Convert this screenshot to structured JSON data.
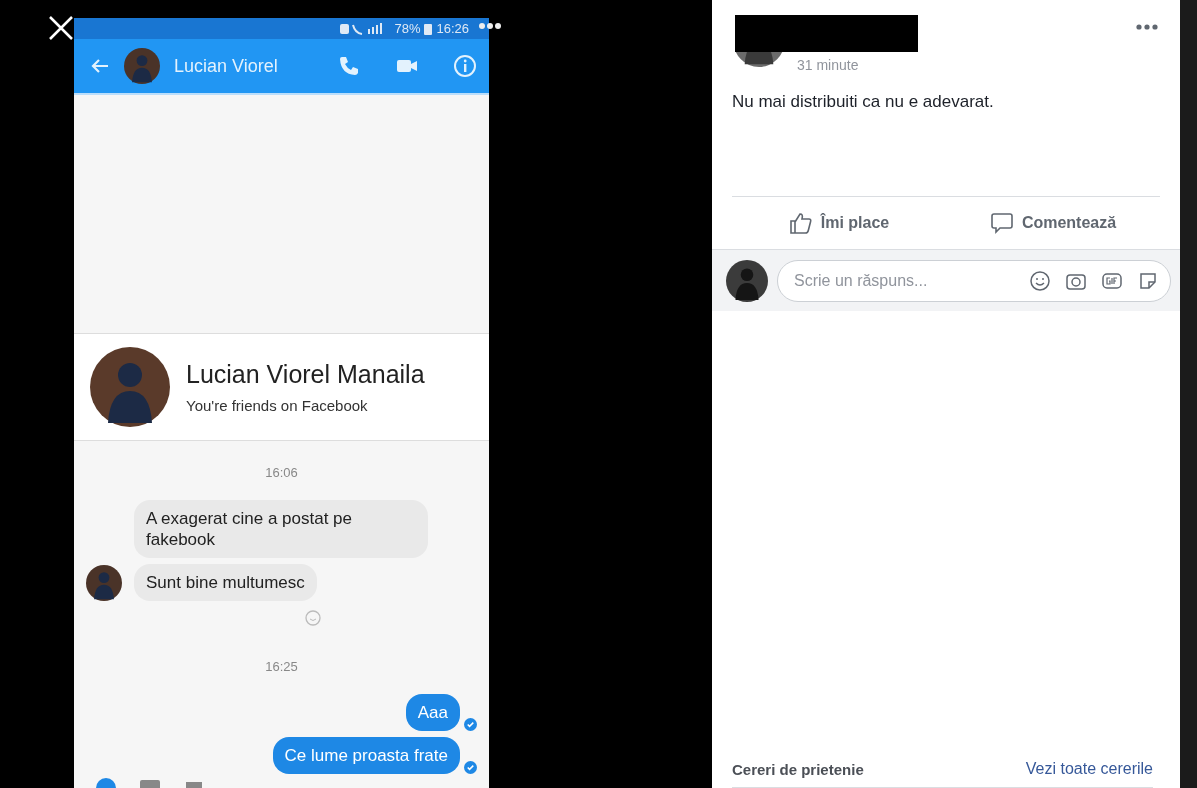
{
  "phone": {
    "status_bar": {
      "battery": "78%",
      "time": "16:26"
    },
    "header": {
      "title": "Lucian Viorel"
    },
    "profile": {
      "name": "Lucian Viorel Manaila",
      "subtitle": "You're friends on Facebook"
    },
    "messages": [
      {
        "kind": "timestamp",
        "text": "16:06"
      },
      {
        "kind": "received",
        "text": "A exagerat cine a postat pe fakebook",
        "avatar": false
      },
      {
        "kind": "received",
        "text": "Sunt bine multumesc",
        "avatar": true
      },
      {
        "kind": "timestamp",
        "text": "16:25"
      },
      {
        "kind": "sent",
        "text": "Aaa"
      },
      {
        "kind": "sent",
        "text": "Ce lume proasta frate"
      }
    ]
  },
  "post": {
    "time": "31 minute",
    "text": "Nu mai distribuiti ca nu e adevarat.",
    "actions": [
      {
        "kind": "like",
        "label": "Îmi place"
      },
      {
        "kind": "comment",
        "label": "Comentează"
      }
    ],
    "reply": {
      "placeholder": "Scrie un răspuns..."
    }
  },
  "friend_requests": {
    "title": "Cereri de prietenie",
    "link": "Vezi toate cererile"
  }
}
